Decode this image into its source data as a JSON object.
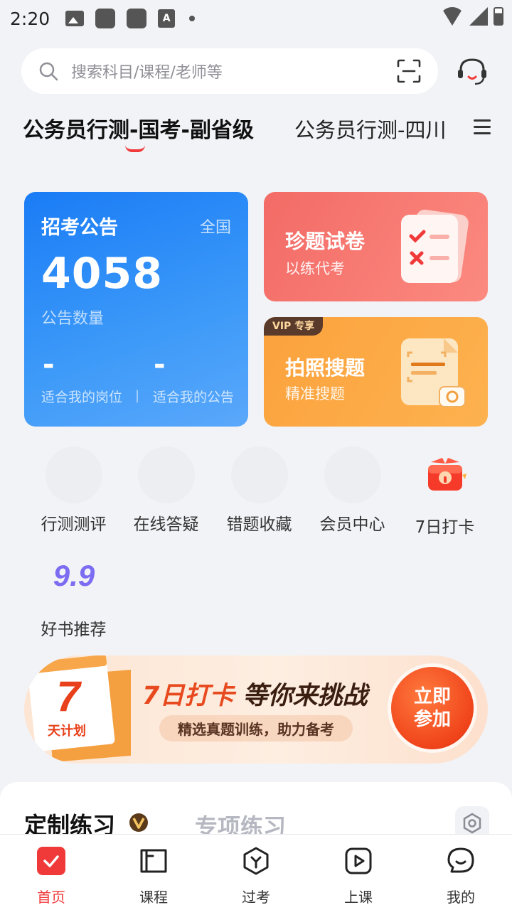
{
  "status_bar": {
    "time": "2:20"
  },
  "search": {
    "placeholder": "搜索科目/课程/老师等"
  },
  "tabs": [
    {
      "label": "公务员行测-国考-副省级",
      "active": true
    },
    {
      "label": "公务员行测-四川",
      "active": false
    }
  ],
  "cards": {
    "recruit": {
      "title": "招考公告",
      "scope": "全国",
      "count": "4058",
      "count_label": "公告数量",
      "stat1_value": "-",
      "stat1_label": "适合我的岗位",
      "stat2_value": "-",
      "stat2_label": "适合我的公告",
      "separator": "|"
    },
    "papers": {
      "title": "珍题试卷",
      "subtitle": "以练代考"
    },
    "photo": {
      "badge": "VIP 专享",
      "title": "拍照搜题",
      "subtitle": "精准搜题"
    }
  },
  "shortcuts": [
    {
      "label": "行测测评"
    },
    {
      "label": "在线答疑"
    },
    {
      "label": "错题收藏"
    },
    {
      "label": "会员中心"
    },
    {
      "label": "7日打卡"
    },
    {
      "label": "好书推荐",
      "icon_text": "9.9"
    }
  ],
  "banner": {
    "calendar_number": "7",
    "calendar_text": "天计划",
    "headline_accent": "7日打卡",
    "headline_main": "等你来挑战",
    "subtitle": "精选真题训练，助力备考",
    "button_line1": "立即",
    "button_line2": "参加"
  },
  "practice": {
    "tab1": "定制练习",
    "tab2": "专项练习"
  },
  "bottom_nav": [
    {
      "label": "首页",
      "active": true
    },
    {
      "label": "课程",
      "active": false
    },
    {
      "label": "过考",
      "active": false
    },
    {
      "label": "上课",
      "active": false
    },
    {
      "label": "我的",
      "active": false
    }
  ],
  "colors": {
    "accent_red": "#f03a3a",
    "card_blue": "#1a7cf6",
    "card_red": "#f36b66",
    "card_orange": "#fba23d",
    "background": "#f2f3f7"
  },
  "icons": [
    "search-icon",
    "scan-icon",
    "customer-service-icon",
    "menu-icon",
    "gift-box-icon",
    "book-9-9-icon",
    "settings-hexagon-icon",
    "home-icon",
    "course-icon",
    "exam-icon",
    "class-icon",
    "profile-icon"
  ]
}
